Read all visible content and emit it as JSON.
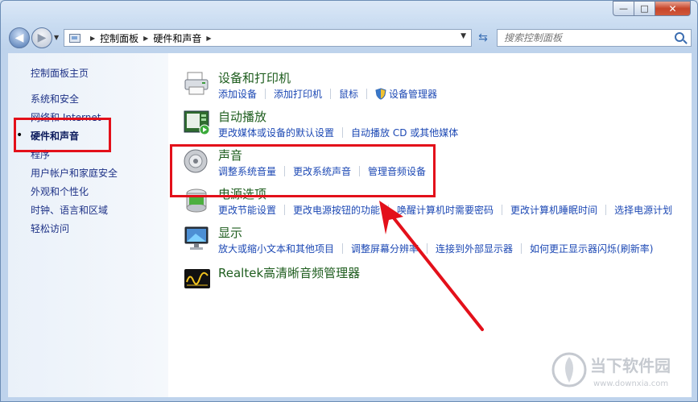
{
  "window": {
    "minimize_glyph": "—",
    "maximize_glyph": "□",
    "close_glyph": "✕"
  },
  "nav": {
    "breadcrumbs": [
      "控制面板",
      "硬件和声音"
    ],
    "search_placeholder": "搜索控制面板"
  },
  "sidebar": {
    "items": [
      {
        "label": "控制面板主页",
        "active": false
      },
      {
        "label": "系统和安全",
        "active": false
      },
      {
        "label": "网络和 Internet",
        "active": false
      },
      {
        "label": "硬件和声音",
        "active": true
      },
      {
        "label": "程序",
        "active": false
      },
      {
        "label": "用户帐户和家庭安全",
        "active": false
      },
      {
        "label": "外观和个性化",
        "active": false
      },
      {
        "label": "时钟、语言和区域",
        "active": false
      },
      {
        "label": "轻松访问",
        "active": false
      }
    ]
  },
  "categories": [
    {
      "title": "设备和打印机",
      "icon": "printer-icon",
      "links": [
        "添加设备",
        "添加打印机",
        "鼠标",
        "设备管理器"
      ]
    },
    {
      "title": "自动播放",
      "icon": "autoplay-icon",
      "links": [
        "更改媒体或设备的默认设置",
        "自动播放 CD 或其他媒体"
      ]
    },
    {
      "title": "声音",
      "icon": "speaker-icon",
      "links": [
        "调整系统音量",
        "更改系统声音",
        "管理音频设备"
      ]
    },
    {
      "title": "电源选项",
      "icon": "power-icon",
      "links": [
        "更改节能设置",
        "更改电源按钮的功能",
        "唤醒计算机时需要密码",
        "更改计算机睡眠时间",
        "选择电源计划"
      ]
    },
    {
      "title": "显示",
      "icon": "monitor-icon",
      "links": [
        "放大或缩小文本和其他项目",
        "调整屏幕分辨率",
        "连接到外部显示器",
        "如何更正显示器闪烁(刷新率)"
      ]
    },
    {
      "title": "Realtek高清晰音频管理器",
      "icon": "realtek-icon",
      "links": []
    }
  ],
  "watermark": {
    "brand": "当下软件园",
    "url": "www.downxia.com"
  },
  "colors": {
    "annotation_red": "#e3101a",
    "link_blue": "#1c48b4",
    "title_green": "#1e5d1e"
  }
}
